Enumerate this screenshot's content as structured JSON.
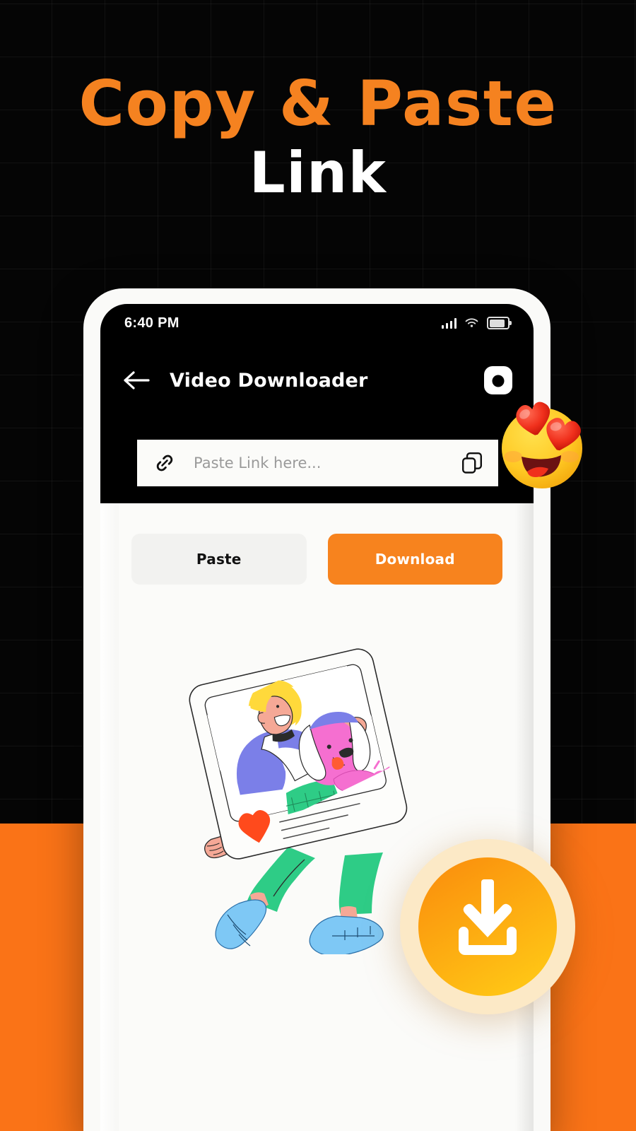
{
  "colors": {
    "background": "#050505",
    "accent_orange": "#FA7317",
    "headline_orange": "#F58220",
    "button_orange": "#F7831E",
    "white": "#FFFFFF",
    "phone_body": "#FAFAF8",
    "placeholder_grey": "#9A9A9A",
    "paste_button_bg": "#F2F2F0"
  },
  "headline": {
    "line1": "Copy & Paste",
    "line2": "Link"
  },
  "phone": {
    "statusbar": {
      "time": "6:40 PM",
      "signal_icon": "signal-bars-icon",
      "wifi_icon": "wifi-icon",
      "battery_icon": "battery-icon"
    },
    "appbar": {
      "back_icon": "back-arrow-icon",
      "title": "Video Downloader",
      "action_icon": "instagram-camera-icon"
    },
    "link_field": {
      "leading_icon": "link-chain-icon",
      "placeholder": "Paste Link here...",
      "value": "",
      "trailing_icon": "copy-icon"
    },
    "actions": {
      "paste_label": "Paste",
      "download_label": "Download"
    },
    "illustration": {
      "name": "person-with-pink-dog-social-post-illustration",
      "heart_icon": "heart-icon"
    }
  },
  "decorations": {
    "emoji": "heart-eyes-emoji",
    "download_badge_icon": "download-arrow-icon"
  }
}
